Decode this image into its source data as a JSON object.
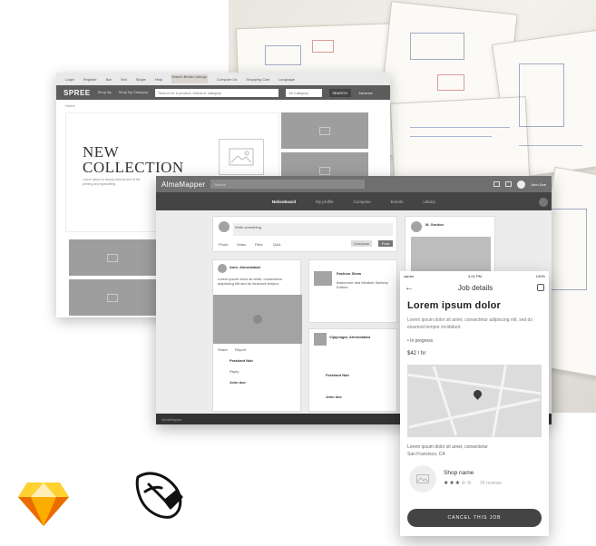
{
  "spree": {
    "top_links": [
      "Login",
      "Register",
      "Bar",
      "Sell",
      "Single",
      "Help",
      "Search Break Listings"
    ],
    "top_right": [
      "Compare Us",
      "Shopping Cart",
      "Language"
    ],
    "logo": "SPREE",
    "nav": [
      "Shop By",
      "Shop By Category"
    ],
    "search_placeholder": "Search for a product, brand or category",
    "category_select": "All Category",
    "search_button": "SEARCH",
    "advance": "Advance",
    "breadcrumb": "Home",
    "hero_title_1": "NEW",
    "hero_title_2": "COLLECTION",
    "hero_sub": "Lorem Ipsum is simply dummy text of the printing and typesetting."
  },
  "alma": {
    "brand": "AlmaMapper",
    "search_placeholder": "Search",
    "user": "John Doe",
    "menu": [
      "Noticeboard",
      "My profile",
      "Compose",
      "Events",
      "Library"
    ],
    "post_placeholder": "Write something",
    "post_actions": [
      "Photo",
      "Video",
      "Files",
      "Q&A"
    ],
    "compose": "Compose",
    "post_button": "Post",
    "feed1_name": "Amir, Ahmedabad",
    "feed1_text": "Lorem ipsum dolor sit amet, consectetur adipiscing elit sed do eiusmod tempor.",
    "comment1": "Prashant Nair",
    "comment2": "John doe",
    "fashion_title": "Fashion Show",
    "fashion_sub": "Brainmore and Mindset Sketchy Editors",
    "vijay": "Vijaynagar, Ahmedabad",
    "profile_name": "M. Gordon",
    "share": "Share",
    "report": "Report",
    "reply": "Reply"
  },
  "phone": {
    "carrier": "carrier",
    "time": "4:21 PM",
    "battery": "100%",
    "screen_title": "Job details",
    "heading": "Lorem ipsum dolor",
    "desc": "Lorem ipsum dolor sit amet, consectetur adipiscing elit, sed do eiusmod tempor incididunt.",
    "status": "In progress",
    "rate": "$42 / hr",
    "address_1": "Lorem ipsum dolor sit amet, consectetur",
    "address_2": "San Francisco, CA",
    "shop_name": "Shop name",
    "stars": "★★★☆☆",
    "reviews": "39 reviews",
    "cancel": "CANCEL THIS JOB"
  },
  "colors": {
    "sketch_orange": "#F7A01B",
    "dark_button": "#444444",
    "placeholder_gray": "#9E9E9E"
  },
  "icons": [
    "sketch-app-icon",
    "pen-tool-icon",
    "map-pin-icon",
    "back-arrow-icon",
    "play-icon"
  ]
}
